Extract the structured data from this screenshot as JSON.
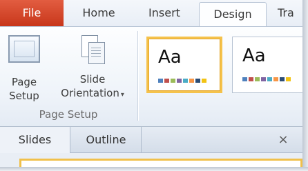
{
  "tabs": {
    "file": "File",
    "home": "Home",
    "insert": "Insert",
    "design": "Design",
    "transitions": "Tra"
  },
  "ribbon": {
    "page_setup_btn": [
      "Page",
      "Setup"
    ],
    "slide_orientation_btn": [
      "Slide",
      "Orientation"
    ],
    "group_label": "Page Setup",
    "themes": [
      {
        "text": "Aa",
        "selected": true
      },
      {
        "text": "Aa",
        "selected": false
      }
    ],
    "swatch_colors": [
      "#4f81bd",
      "#c0504d",
      "#9bbb59",
      "#8064a2",
      "#4bacc6",
      "#f79646",
      "#2c4d75",
      "#f2c314"
    ]
  },
  "pane": {
    "slides_tab": "Slides",
    "outline_tab": "Outline",
    "close_glyph": "×"
  },
  "colors": {
    "file_tab": "#d04424",
    "selection": "#f5c24b"
  }
}
